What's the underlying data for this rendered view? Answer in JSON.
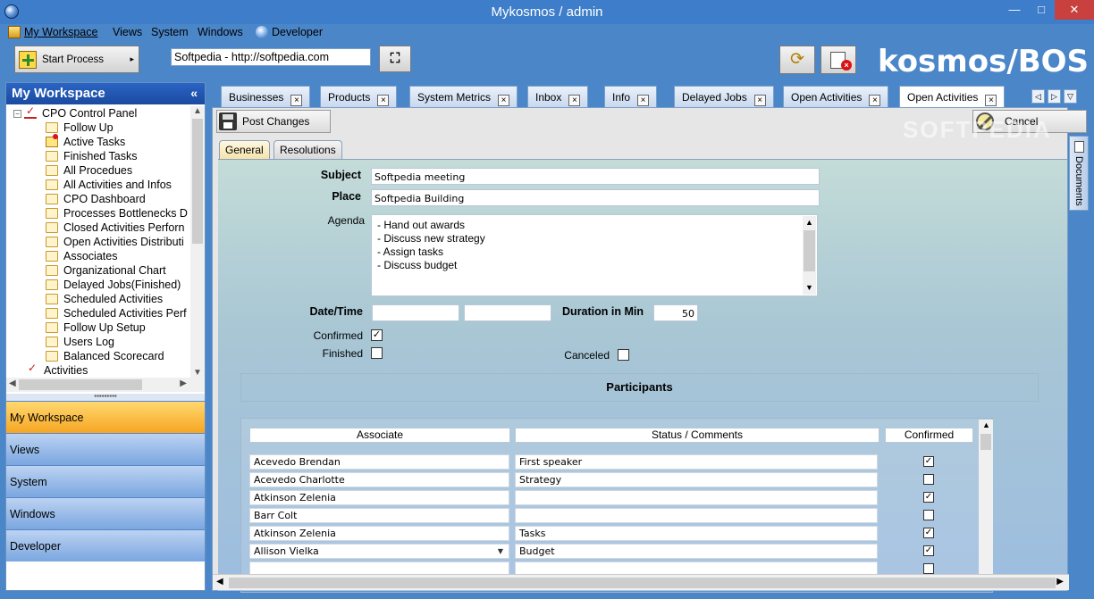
{
  "window": {
    "title": "Mykosmos / admin",
    "minimize": "—",
    "maximize": "□",
    "close": "✕"
  },
  "menu": [
    {
      "label": "My Workspace",
      "icon": "workspace-icon"
    },
    {
      "label": "Views"
    },
    {
      "label": "System"
    },
    {
      "label": "Windows"
    },
    {
      "label": "Developer",
      "icon": "developer-icon"
    }
  ],
  "toolbar": {
    "start_process": "Start Process",
    "start_arrow": "▸",
    "url_value": "Softpedia - http://softpedia.com",
    "binoculars": "⛶",
    "sync": "⟳",
    "brand": "kosmos/BOS"
  },
  "workspace": {
    "header": "My Workspace",
    "collapse": "«",
    "root": "CPO Control Panel",
    "items": [
      "Follow Up",
      "Active Tasks",
      "Finished Tasks",
      "All Procedues",
      "All Activities and Infos",
      "CPO Dashboard",
      "Processes Bottlenecks D",
      "Closed Activities Perforn",
      "Open Activities Distributi",
      "Associates",
      "Organizational Chart",
      "Delayed Jobs(Finished)",
      "Scheduled Activities",
      "Scheduled Activities Perf",
      "Follow Up Setup",
      "Users Log",
      "Balanced Scorecard"
    ],
    "activities": "Activities",
    "splitter": "▪▪▪▪▪▪▪▪▪",
    "nav": [
      "My Workspace",
      "Views",
      "System",
      "Windows",
      "Developer"
    ]
  },
  "tabs": [
    "Businesses",
    "Products",
    "System Metrics",
    "Inbox",
    "Info",
    "Delayed Jobs",
    "Open Activities",
    "Open Activities"
  ],
  "tab_nav": [
    "◁",
    "▷",
    "▽"
  ],
  "actions": {
    "post": "Post Changes",
    "cancel": "Cancel"
  },
  "subtabs": [
    "General",
    "Resolutions"
  ],
  "form": {
    "subject_label": "Subject",
    "subject_value": "Softpedia meeting",
    "place_label": "Place",
    "place_value": "Softpedia Building",
    "agenda_label": "Agenda",
    "agenda_lines": [
      "- Hand out awards",
      "- Discuss new strategy",
      "- Assign tasks",
      "- Discuss budget"
    ],
    "datetime_label": "Date/Time",
    "duration_label": "Duration in Min",
    "duration_value": "50",
    "confirmed_label": "Confirmed",
    "finished_label": "Finished",
    "canceled_label": "Canceled",
    "check_mark": "✓"
  },
  "participants": {
    "title": "Participants",
    "headers": [
      "Associate",
      "Status / Comments",
      "Confirmed"
    ],
    "rows": [
      {
        "associate": "Acevedo Brendan",
        "status": "First speaker",
        "confirmed": true
      },
      {
        "associate": "Acevedo Charlotte",
        "status": "Strategy",
        "confirmed": false
      },
      {
        "associate": "Atkinson Zelenia",
        "status": "",
        "confirmed": true
      },
      {
        "associate": "Barr Colt",
        "status": "",
        "confirmed": false
      },
      {
        "associate": "Atkinson Zelenia",
        "status": "Tasks",
        "confirmed": true
      },
      {
        "associate": "Allison Vielka",
        "status": "Budget",
        "confirmed": true
      }
    ]
  },
  "side": {
    "documents": "Documents"
  },
  "watermark": "SOFTPEDIA",
  "colors": {
    "titlebar": "#3d7dc9",
    "accent": "#f6a623",
    "close": "#c8413f"
  }
}
